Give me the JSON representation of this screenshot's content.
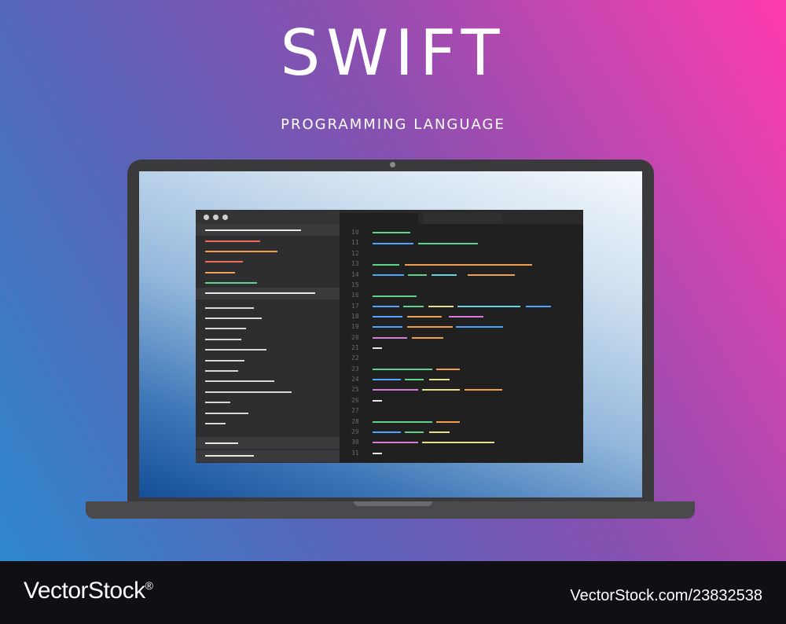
{
  "heading": {
    "title": "SWIFT",
    "subtitle": "PROGRAMMING LANGUAGE"
  },
  "editor": {
    "line_numbers": [
      "10",
      "11",
      "12",
      "13",
      "14",
      "15",
      "16",
      "17",
      "18",
      "19",
      "20",
      "21",
      "22",
      "23",
      "24",
      "25",
      "26",
      "27",
      "28",
      "29",
      "30",
      "31"
    ]
  },
  "footer": {
    "brand": "VectorStock",
    "registered": "®",
    "stock_id": "VectorStock.com/23832538"
  },
  "colors": {
    "code_green": "#5fd38a",
    "code_blue": "#4ea4ff",
    "code_orange": "#f0a050",
    "code_pink": "#d97ad6",
    "code_yellow": "#e6e08a",
    "code_cyan": "#5ed6e0",
    "code_red": "#f06a5a",
    "code_white": "#e8e8e8"
  }
}
